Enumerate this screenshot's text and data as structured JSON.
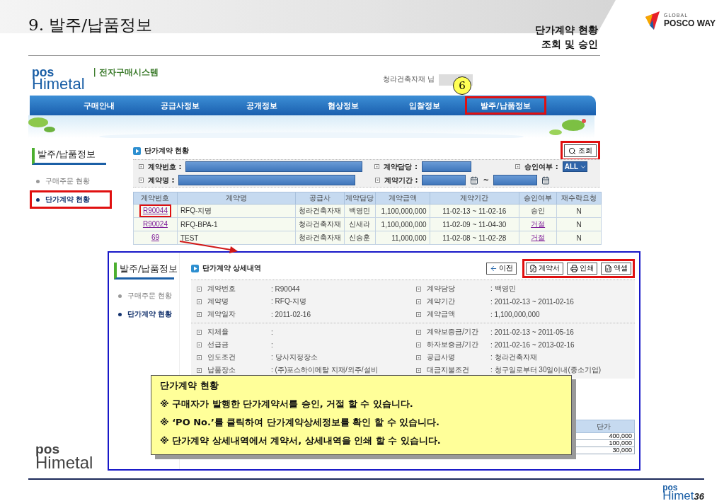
{
  "slide": {
    "title": "9. 발주/납품정보",
    "subtitle": [
      "단가계약 현황",
      "조회 및 승인"
    ],
    "brand": {
      "small": "GLOBAL",
      "name": "POSCO WAY"
    },
    "footer_logo": {
      "top": "pos",
      "bottom": "Himet"
    },
    "page_number": "36"
  },
  "portal": {
    "logo": {
      "top": "pos",
      "bottom": "Himetal"
    },
    "system_name": "| 전자구매시스템",
    "user": "청라건축자재 님",
    "step_marker": "6",
    "nav": [
      {
        "label": "구매안내",
        "selected": false
      },
      {
        "label": "공급사정보",
        "selected": false
      },
      {
        "label": "공개정보",
        "selected": false
      },
      {
        "label": "협상정보",
        "selected": false
      },
      {
        "label": "입찰정보",
        "selected": false
      },
      {
        "label": "발주/납품정보",
        "selected": true
      }
    ],
    "sidebar": {
      "title": "발주/납품정보",
      "items": [
        {
          "label": "구매주문 현황",
          "selected": false,
          "highlighted": false
        },
        {
          "label": "단가계약 현황",
          "selected": true,
          "highlighted": true
        }
      ]
    },
    "panel": {
      "title": "단가계약 현황",
      "search_button": {
        "label": "조회",
        "highlighted": true
      },
      "filters": [
        [
          {
            "label": "계약번호 :",
            "kind": "text"
          },
          {
            "label": "계약담당 :",
            "kind": "short"
          },
          {
            "label": "승인여부 :",
            "kind": "select",
            "value": "ALL"
          }
        ],
        [
          {
            "label": "계약명 :",
            "kind": "text"
          },
          {
            "label": "계약기간 :",
            "kind": "date_range",
            "separator": "~"
          }
        ]
      ],
      "table": {
        "columns": [
          "계약번호",
          "계약명",
          "공급사",
          "계약담당",
          "계약금액",
          "계약기간",
          "승인여부",
          "재수락요청"
        ],
        "rows": [
          {
            "po_no": "R90044",
            "name": "RFQ-지명",
            "supplier": "청라건축자재",
            "manager": "백영민",
            "amount": "1,100,000,000",
            "period": "11-02-13 ~ 11-02-16",
            "approval": "승인",
            "approval_link": false,
            "reaccept": "N",
            "highlighted": true
          },
          {
            "po_no": "R90024",
            "name": "RFQ-BPA-1",
            "supplier": "청라건축자재",
            "manager": "신새라",
            "amount": "1,100,000,000",
            "period": "11-02-09 ~ 11-04-30",
            "approval": "거절",
            "approval_link": true,
            "reaccept": "N",
            "highlighted": false
          },
          {
            "po_no": "69",
            "name": "TEST",
            "supplier": "청라건축자재",
            "manager": "신승훈",
            "amount": "11,000,000",
            "period": "11-02-08 ~ 11-02-28",
            "approval": "거절",
            "approval_link": true,
            "reaccept": "N",
            "highlighted": false
          }
        ]
      }
    },
    "footer_logo": {
      "top": "pos",
      "bottom": "Himetal"
    }
  },
  "detail": {
    "sidebar": {
      "title": "발주/납품정보",
      "items": [
        {
          "label": "구매주문 현황",
          "selected": false
        },
        {
          "label": "단가계약 현황",
          "selected": true
        }
      ]
    },
    "title": "단가계약 상세내역",
    "back_button": "이전",
    "document_buttons": {
      "highlighted": true,
      "items": [
        {
          "label": "계약서",
          "kind": "contract"
        },
        {
          "label": "인쇄",
          "kind": "print"
        },
        {
          "label": "엑셀",
          "kind": "excel"
        }
      ]
    },
    "sections": [
      [
        {
          "left": {
            "label": "계약번호",
            "value": ": R90044"
          },
          "right": {
            "label": "계약담당",
            "value": ": 백영민"
          }
        },
        {
          "left": {
            "label": "계약명",
            "value": ": RFQ-지명"
          },
          "right": {
            "label": "계약기간",
            "value": ": 2011-02-13 ~ 2011-02-16"
          }
        },
        {
          "left": {
            "label": "계약일자",
            "value": ": 2011-02-16"
          },
          "right": {
            "label": "계약금액",
            "value": ": 1,100,000,000"
          }
        }
      ],
      [
        {
          "left": {
            "label": "지체율",
            "value": ":"
          },
          "right": {
            "label": "계약보증금/기간",
            "value": ": 2011-02-13 ~ 2011-05-16"
          }
        },
        {
          "left": {
            "label": "선급금",
            "value": ":"
          },
          "right": {
            "label": "하자보증금/기간",
            "value": ": 2011-02-16 ~ 2013-02-16"
          }
        },
        {
          "left": {
            "label": "인도조건",
            "value": ": 당사지정장소"
          },
          "right": {
            "label": "공급사명",
            "value": ": 청라건축자재"
          }
        },
        {
          "left": {
            "label": "납품장소",
            "value": ": (주)포스하이메탈 지재/외주/설비"
          },
          "right": {
            "label": "대금지불조건",
            "value": ": 청구일로부터 30일이내(중소기업)"
          }
        }
      ]
    ],
    "price_table": {
      "column": "단가",
      "values": [
        "400,000",
        "100,000",
        "30,000"
      ]
    }
  },
  "callout": {
    "title": "단가계약 현황",
    "lines": [
      "※ 구매자가 발행한 단가계약서를 승인, 거절 할 수 있습니다.",
      "※ ‘PO No.’를 클릭하여 단가계약상세정보를 확인 할 수 있습니다.",
      "※ 단가계약 상세내역에서 계약서, 상세내역을 인쇄 할 수 있습니다."
    ]
  }
}
